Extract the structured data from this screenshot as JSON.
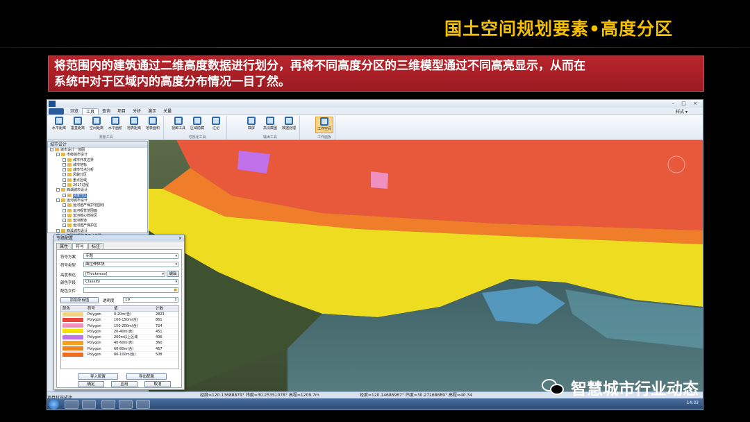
{
  "slide": {
    "title": "国土空间规划要素•高度分区",
    "banner_line1": "将范围内的建筑通过二维高度数据进行划分，再将不同高度分区的三维模型通过不同高亮显示，从而在",
    "banner_line2": "系统中对于区域内的高度分布情况一目了然。"
  },
  "app": {
    "menu_tabs": [
      "浏览",
      "工具",
      "查询",
      "项目",
      "分析",
      "演示",
      "关量"
    ],
    "active_tab": "工具",
    "style_label": "样式 ▾",
    "ribbon": {
      "groups": [
        {
          "label": "测量工具",
          "buttons": [
            "水平距离",
            "垂直距离",
            "空间距离",
            "水平面积",
            "地表距离",
            "地表面积"
          ]
        },
        {
          "label": "可视化工具",
          "buttons": [
            "视廊工具",
            "区域隐藏",
            "注记"
          ]
        },
        {
          "label": "输出工具",
          "buttons": [
            "截屏",
            "高清截图",
            "数据处理"
          ]
        },
        {
          "label": "工作面板",
          "buttons": [
            "工作空间"
          ]
        }
      ]
    },
    "tree": {
      "header": "城市设计",
      "items": [
        {
          "label": "城市设计一体图",
          "indent": 0
        },
        {
          "label": "市级城市设计",
          "indent": 1
        },
        {
          "label": "城市开发边界",
          "indent": 2
        },
        {
          "label": "城市地标",
          "indent": 2
        },
        {
          "label": "城市节点分析",
          "indent": 2
        },
        {
          "label": "风貌分区",
          "indent": 2
        },
        {
          "label": "重点区域",
          "indent": 2
        },
        {
          "label": "2017过程",
          "indent": 2
        },
        {
          "label": "西湖城市设计",
          "indent": 1
        },
        {
          "label": "高度分区",
          "indent": 2,
          "selected": true
        },
        {
          "label": "运河城市设计",
          "indent": 1
        },
        {
          "label": "运河遗产保护范围线",
          "indent": 2
        },
        {
          "label": "运河视觉范围面",
          "indent": 2
        },
        {
          "label": "运河核心管控区",
          "indent": 2
        },
        {
          "label": "运河廊道",
          "indent": 2
        },
        {
          "label": "运河遗产保护区",
          "indent": 2
        },
        {
          "label": "西溪城市设计",
          "indent": 1
        },
        {
          "label": "基础地理信息平台专题",
          "indent": 1
        }
      ]
    },
    "status": {
      "coord1": "经度=120.13688879°  纬度=30.25351078°  高程=1209.7m",
      "coord2": "经度=120.14686967°  纬度=30.27268689°  高程=40.34",
      "message": "项目打开成功.",
      "clock": "14:33"
    },
    "dialog": {
      "title": "专题配置",
      "close": "×",
      "tabs": [
        "属性",
        "符号",
        "标注"
      ],
      "active_tab": "符号",
      "fields": {
        "scheme_label": "符号方案",
        "scheme_value": "专题",
        "type_label": "符号类型",
        "type_value": "面拉伸体块",
        "height_label": "高度表达",
        "height_value": "[Thickness]",
        "edit_btn": "编辑",
        "color_field_label": "颜色字段",
        "color_field_value": "Classify",
        "color_file_label": "配色文件"
      },
      "add_all_btn": "添加所有值",
      "transparency_label": "透明度",
      "transparency_value": "19",
      "table_headers": [
        "颜色",
        "符号",
        "值",
        "计数"
      ],
      "rows": [
        {
          "color": "#f2d27e",
          "symbol": "Polygon",
          "value": "0-20m(含)",
          "count": "2823"
        },
        {
          "color": "#e8453c",
          "symbol": "Polygon",
          "value": "100-150m(含)",
          "count": "861"
        },
        {
          "color": "#f090c0",
          "symbol": "Polygon",
          "value": "150-200m(含)",
          "count": "724"
        },
        {
          "color": "#f5e400",
          "symbol": "Polygon",
          "value": "20-40m(含)",
          "count": "451"
        },
        {
          "color": "#c070e8",
          "symbol": "Polygon",
          "value": "200m以上区域",
          "count": "406"
        },
        {
          "color": "#f5a020",
          "symbol": "Polygon",
          "value": "40-60m(含)",
          "count": "360"
        },
        {
          "color": "#f08420",
          "symbol": "Polygon",
          "value": "60-80m(含)",
          "count": "467"
        },
        {
          "color": "#ec6c22",
          "symbol": "Polygon",
          "value": "80-100m(含)",
          "count": "508"
        }
      ],
      "import_btn": "导入配置",
      "export_btn": "导出配置",
      "ok_btn": "确定",
      "apply_btn": "应用",
      "cancel_btn": "取消"
    }
  },
  "watermark": {
    "icon": "wechat-icon",
    "text": "智慧城市行业动态"
  }
}
